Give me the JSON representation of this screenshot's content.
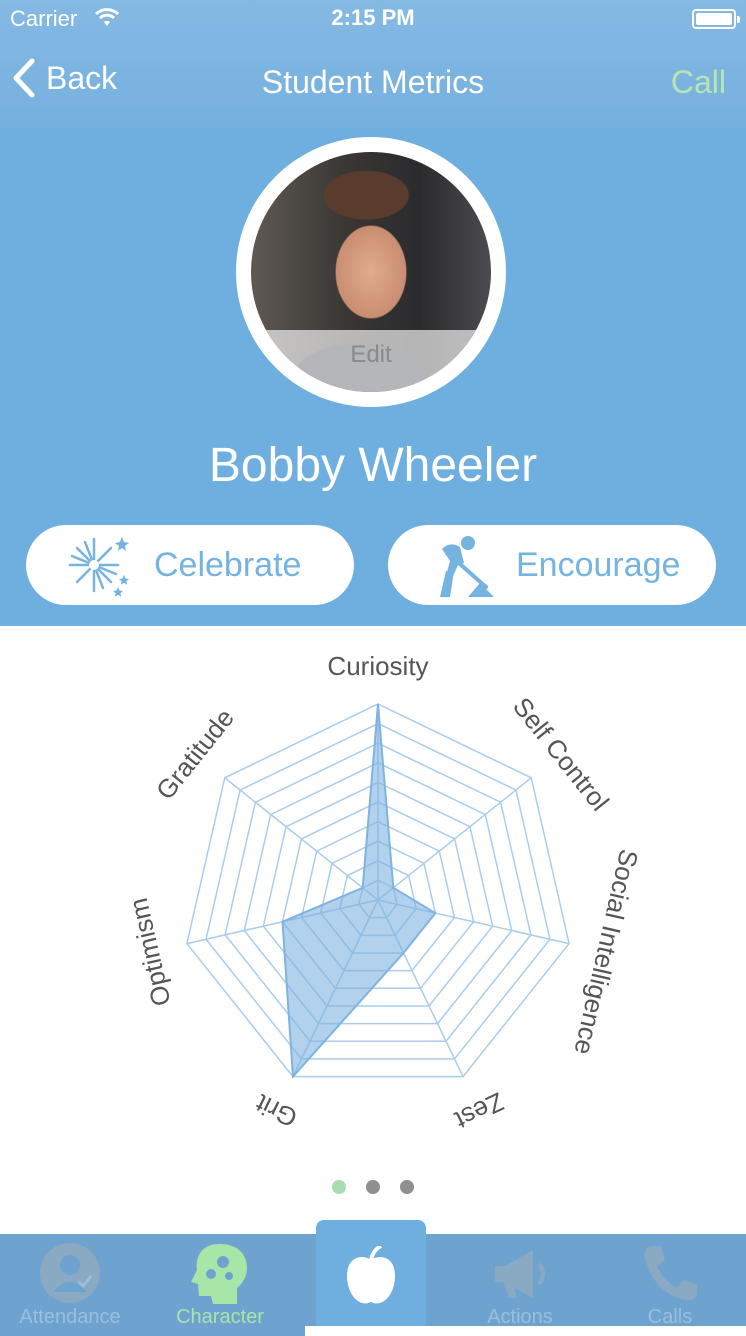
{
  "status": {
    "carrier": "Carrier",
    "time": "2:15 PM"
  },
  "nav": {
    "back_label": "Back",
    "title": "Student Metrics",
    "call_label": "Call"
  },
  "profile": {
    "name": "Bobby Wheeler",
    "edit_label": "Edit",
    "celebrate_label": "Celebrate",
    "encourage_label": "Encourage"
  },
  "chart_data": {
    "type": "radar",
    "categories": [
      "Curiosity",
      "Self Control",
      "Social Intelligence",
      "Zest",
      "Grit",
      "Optimism",
      "Gratitude"
    ],
    "values": [
      10,
      1,
      3,
      3,
      10,
      5,
      1
    ],
    "rmax": 10,
    "rings": 10,
    "color": "#7fb3e0"
  },
  "pager": {
    "count": 3,
    "active": 0
  },
  "tabs": [
    {
      "label": "Attendance",
      "icon": "attendance-icon"
    },
    {
      "label": "Character",
      "icon": "character-icon",
      "active": true
    },
    {
      "label": "",
      "icon": "apple-icon",
      "center": true
    },
    {
      "label": "Actions",
      "icon": "megaphone-icon"
    },
    {
      "label": "Calls",
      "icon": "phone-icon"
    }
  ],
  "colors": {
    "accent": "#6fafdf",
    "call": "#b8e6b1",
    "chart": "#7fb3e0",
    "tab_active": "#a7e6a6"
  }
}
